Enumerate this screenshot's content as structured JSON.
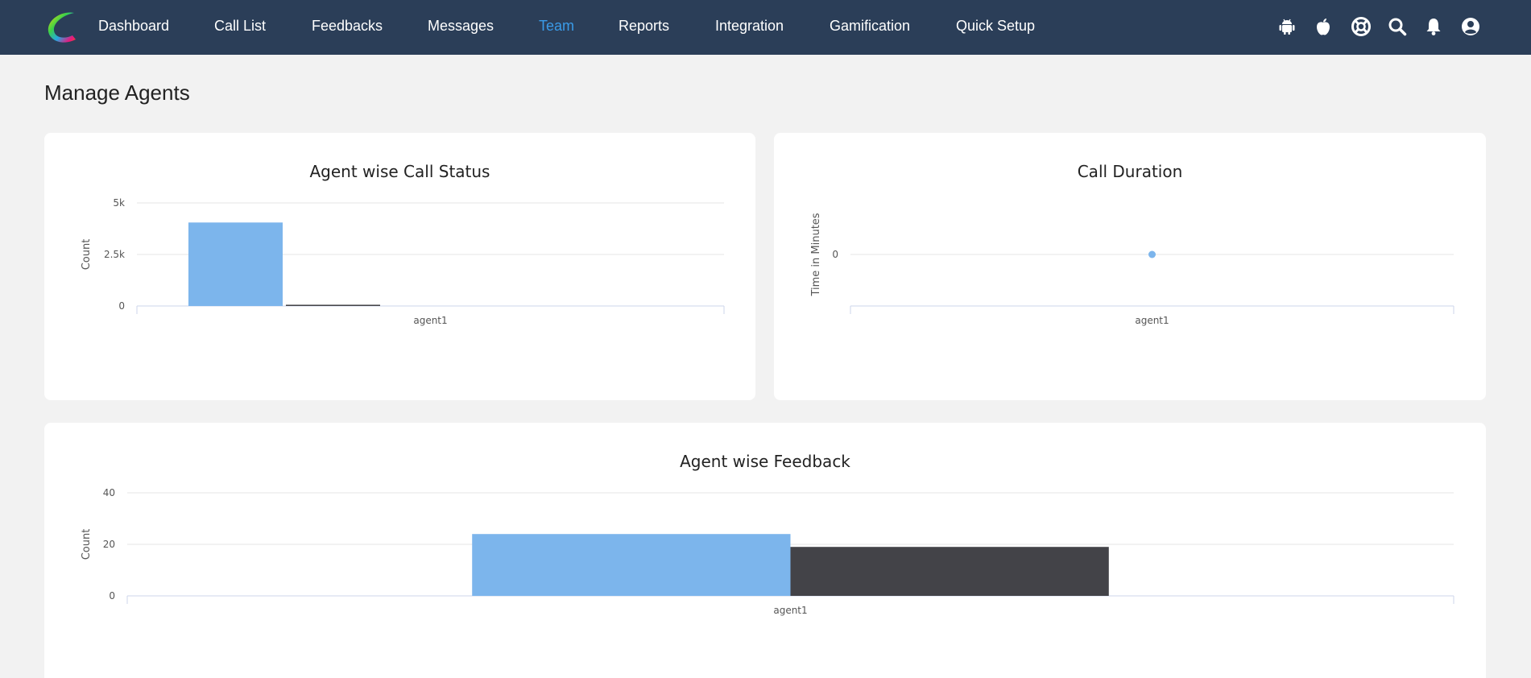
{
  "nav": {
    "items": [
      {
        "label": "Dashboard",
        "active": false
      },
      {
        "label": "Call List",
        "active": false
      },
      {
        "label": "Feedbacks",
        "active": false
      },
      {
        "label": "Messages",
        "active": false
      },
      {
        "label": "Team",
        "active": true
      },
      {
        "label": "Reports",
        "active": false
      },
      {
        "label": "Integration",
        "active": false
      },
      {
        "label": "Gamification",
        "active": false
      },
      {
        "label": "Quick Setup",
        "active": false
      }
    ],
    "icons": [
      "android-icon",
      "apple-icon",
      "support-icon",
      "search-icon",
      "bell-icon",
      "user-icon"
    ],
    "active_color": "#3a9be8",
    "background": "#2b3e58"
  },
  "page": {
    "title": "Manage Agents"
  },
  "chart_data": [
    {
      "type": "bar",
      "title": "Agent wise Call Status",
      "ylabel": "Count",
      "xlabel": "",
      "categories": [
        "agent1"
      ],
      "ylim": [
        0,
        5000
      ],
      "yticks": [
        {
          "value": 0,
          "label": "0"
        },
        {
          "value": 2500,
          "label": "2.5k"
        },
        {
          "value": 5000,
          "label": "5k"
        }
      ],
      "grid": true,
      "series": [
        {
          "values": [
            4050
          ],
          "color": "#7cb5ec"
        },
        {
          "values": [
            60
          ],
          "color": "#434348"
        },
        {
          "values": [
            0
          ],
          "color": "#90ed7d"
        },
        {
          "values": [
            0
          ],
          "color": "#f7a35c"
        },
        {
          "values": [
            0
          ],
          "color": "#8085e9"
        }
      ]
    },
    {
      "type": "scatter",
      "title": "Call Duration",
      "ylabel": "Time in Minutes",
      "xlabel": "",
      "categories": [
        "agent1"
      ],
      "yticks": [
        {
          "value": 0,
          "label": "0"
        }
      ],
      "grid": true,
      "series": [
        {
          "values": [
            0
          ],
          "color": "#7cb5ec"
        }
      ]
    },
    {
      "type": "bar",
      "title": "Agent wise Feedback",
      "ylabel": "Count",
      "xlabel": "",
      "categories": [
        "agent1"
      ],
      "ylim": [
        0,
        40
      ],
      "yticks": [
        {
          "value": 0,
          "label": "0"
        },
        {
          "value": 20,
          "label": "20"
        },
        {
          "value": 40,
          "label": "40"
        }
      ],
      "grid": true,
      "series": [
        {
          "values": [
            24
          ],
          "color": "#7cb5ec"
        },
        {
          "values": [
            19
          ],
          "color": "#434348"
        }
      ]
    }
  ]
}
